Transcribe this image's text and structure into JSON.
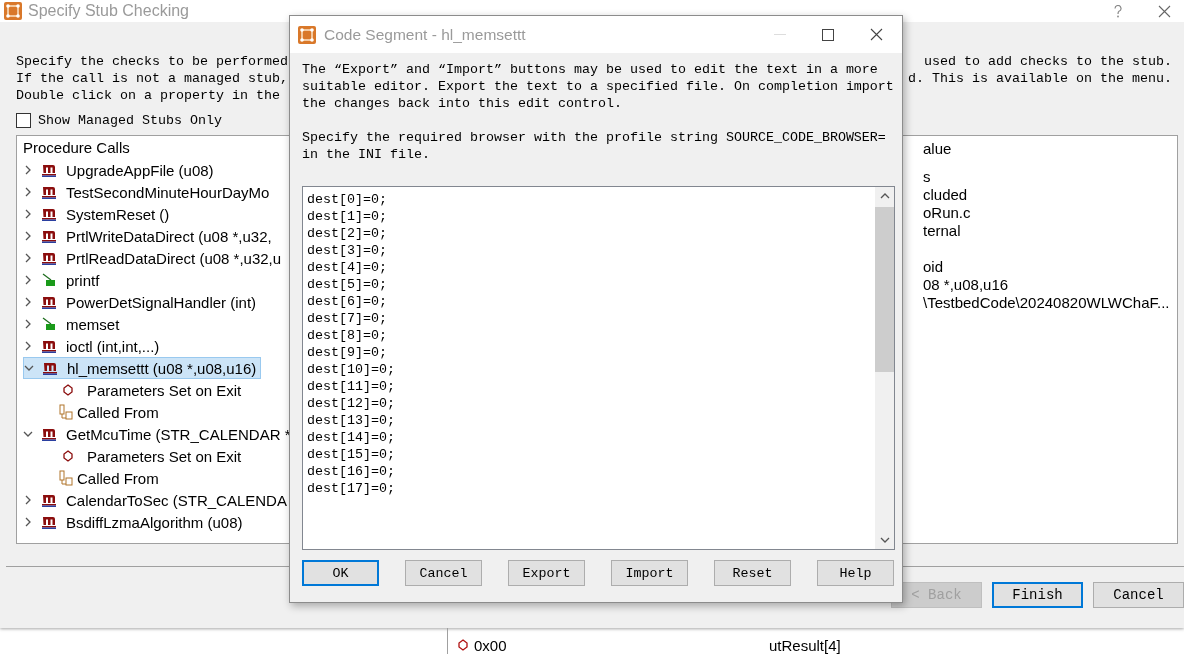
{
  "window": {
    "title": "Specify Stub Checking"
  },
  "intro": [
    {
      "left": "Specify the checks to be performed",
      "right": "used to add checks to the stub."
    },
    {
      "left": "If the call is not a managed stub,",
      "right": "d. This is available on the menu."
    },
    {
      "left": "Double click on a property in the"
    }
  ],
  "show_managed_only": {
    "label": "Show Managed Stubs Only",
    "checked": false
  },
  "tree": {
    "header": "Procedure Calls",
    "items": [
      {
        "kind": "method",
        "label": "UpgradeAppFile (u08)",
        "expanded": false,
        "selected": false
      },
      {
        "kind": "method",
        "label": "TestSecondMinuteHourDayMo",
        "expanded": false,
        "selected": false
      },
      {
        "kind": "method",
        "label": "SystemReset ()",
        "expanded": false,
        "selected": false
      },
      {
        "kind": "method",
        "label": "PrtlWriteDataDirect (u08 *,u32,",
        "expanded": false,
        "selected": false
      },
      {
        "kind": "method",
        "label": "PrtlReadDataDirect (u08 *,u32,u",
        "expanded": false,
        "selected": false
      },
      {
        "kind": "function",
        "label": "printf",
        "expanded": false,
        "selected": false
      },
      {
        "kind": "method",
        "label": "PowerDetSignalHandler (int)",
        "expanded": false,
        "selected": false
      },
      {
        "kind": "function",
        "label": "memset",
        "expanded": false,
        "selected": false
      },
      {
        "kind": "method",
        "label": "ioctl (int,int,...)",
        "expanded": false,
        "selected": false
      },
      {
        "kind": "method",
        "label": "hl_memsettt (u08 *,u08,u16)",
        "expanded": true,
        "selected": true,
        "children": [
          {
            "kind": "params",
            "label": "Parameters Set on Exit",
            "selected": false
          },
          {
            "kind": "called_from",
            "label": "Called From",
            "selected": false
          }
        ]
      },
      {
        "kind": "method",
        "label": "GetMcuTime (STR_CALENDAR *",
        "expanded": true,
        "selected": false,
        "children": [
          {
            "kind": "params",
            "label": "Parameters Set on Exit",
            "selected": false
          },
          {
            "kind": "called_from",
            "label": "Called From",
            "selected": false
          }
        ]
      },
      {
        "kind": "method",
        "label": "CalendarToSec (STR_CALENDA",
        "expanded": false,
        "selected": false
      },
      {
        "kind": "method",
        "label": "BsdiffLzmaAlgorithm (u08)",
        "expanded": false,
        "selected": false
      }
    ]
  },
  "properties": {
    "header": "alue",
    "groups": [
      [
        "s",
        "cluded",
        "oRun.c",
        "ternal"
      ],
      [
        "oid",
        "08 *,u08,u16",
        "\\TestbedCode\\20240820WLWChaF..."
      ]
    ]
  },
  "buttons": [
    {
      "label": "< Back",
      "disabled": true,
      "focused": false
    },
    {
      "label": "Finish",
      "disabled": false,
      "focused": true
    },
    {
      "label": "Cancel",
      "disabled": false,
      "focused": false
    }
  ],
  "dialog": {
    "title": "Code Segment - hl_memsettt",
    "help": [
      [
        "The “Export” and “Import” buttons may be used to edit the text in a more",
        "suitable editor. Export the text to a specified file. On completion import",
        "the changes back into this edit control."
      ],
      [
        "Specify the required browser with the profile string SOURCE_CODE_BROWSER=",
        "in the INI file."
      ]
    ],
    "code": "dest[0]=0;\ndest[1]=0;\ndest[2]=0;\ndest[3]=0;\ndest[4]=0;\ndest[5]=0;\ndest[6]=0;\ndest[7]=0;\ndest[8]=0;\ndest[9]=0;\ndest[10]=0;\ndest[11]=0;\ndest[12]=0;\ndest[13]=0;\ndest[14]=0;\ndest[15]=0;\ndest[16]=0;\ndest[17]=0;",
    "buttons": [
      {
        "label": "OK",
        "focused": true
      },
      {
        "label": "Cancel",
        "focused": false
      },
      {
        "label": "Export",
        "focused": false
      },
      {
        "label": "Import",
        "focused": false
      },
      {
        "label": "Reset",
        "focused": false
      },
      {
        "label": "Help",
        "focused": false
      }
    ]
  },
  "background_list": [
    {
      "value": "0x00",
      "name": "utResult[4]"
    }
  ]
}
